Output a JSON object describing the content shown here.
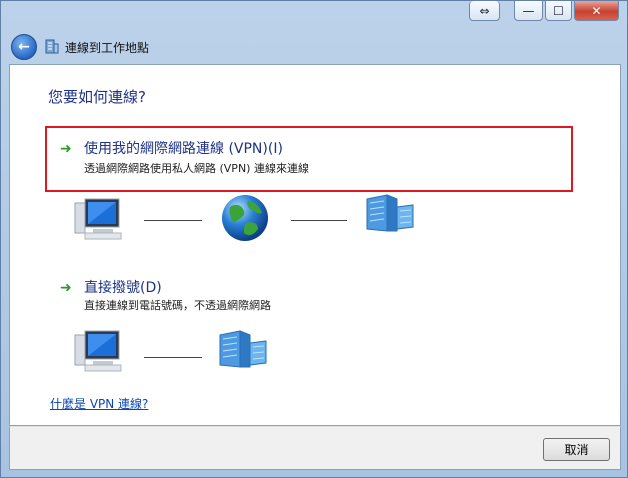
{
  "window": {
    "title": "連線到工作地點",
    "buttons": {
      "swap": "⇔",
      "minimize": "—",
      "maximize": "☐",
      "close": "✕"
    }
  },
  "page": {
    "heading": "您要如何連線?"
  },
  "options": [
    {
      "title": "使用我的網際網路連線 (VPN)(I)",
      "description": "透過網際網路使用私人網路 (VPN) 連線來連線",
      "selected": true
    },
    {
      "title": "直接撥號(D)",
      "description": "直接連線到電話號碼，不透過網際網路",
      "selected": false
    }
  ],
  "help_link": "什麼是 VPN 連線?",
  "footer": {
    "cancel_label": "取消"
  },
  "icons": {
    "back": "back-arrow-icon",
    "option_arrow": "green-arrow-icon",
    "computer": "computer-icon",
    "globe": "globe-icon",
    "building": "building-icon"
  }
}
